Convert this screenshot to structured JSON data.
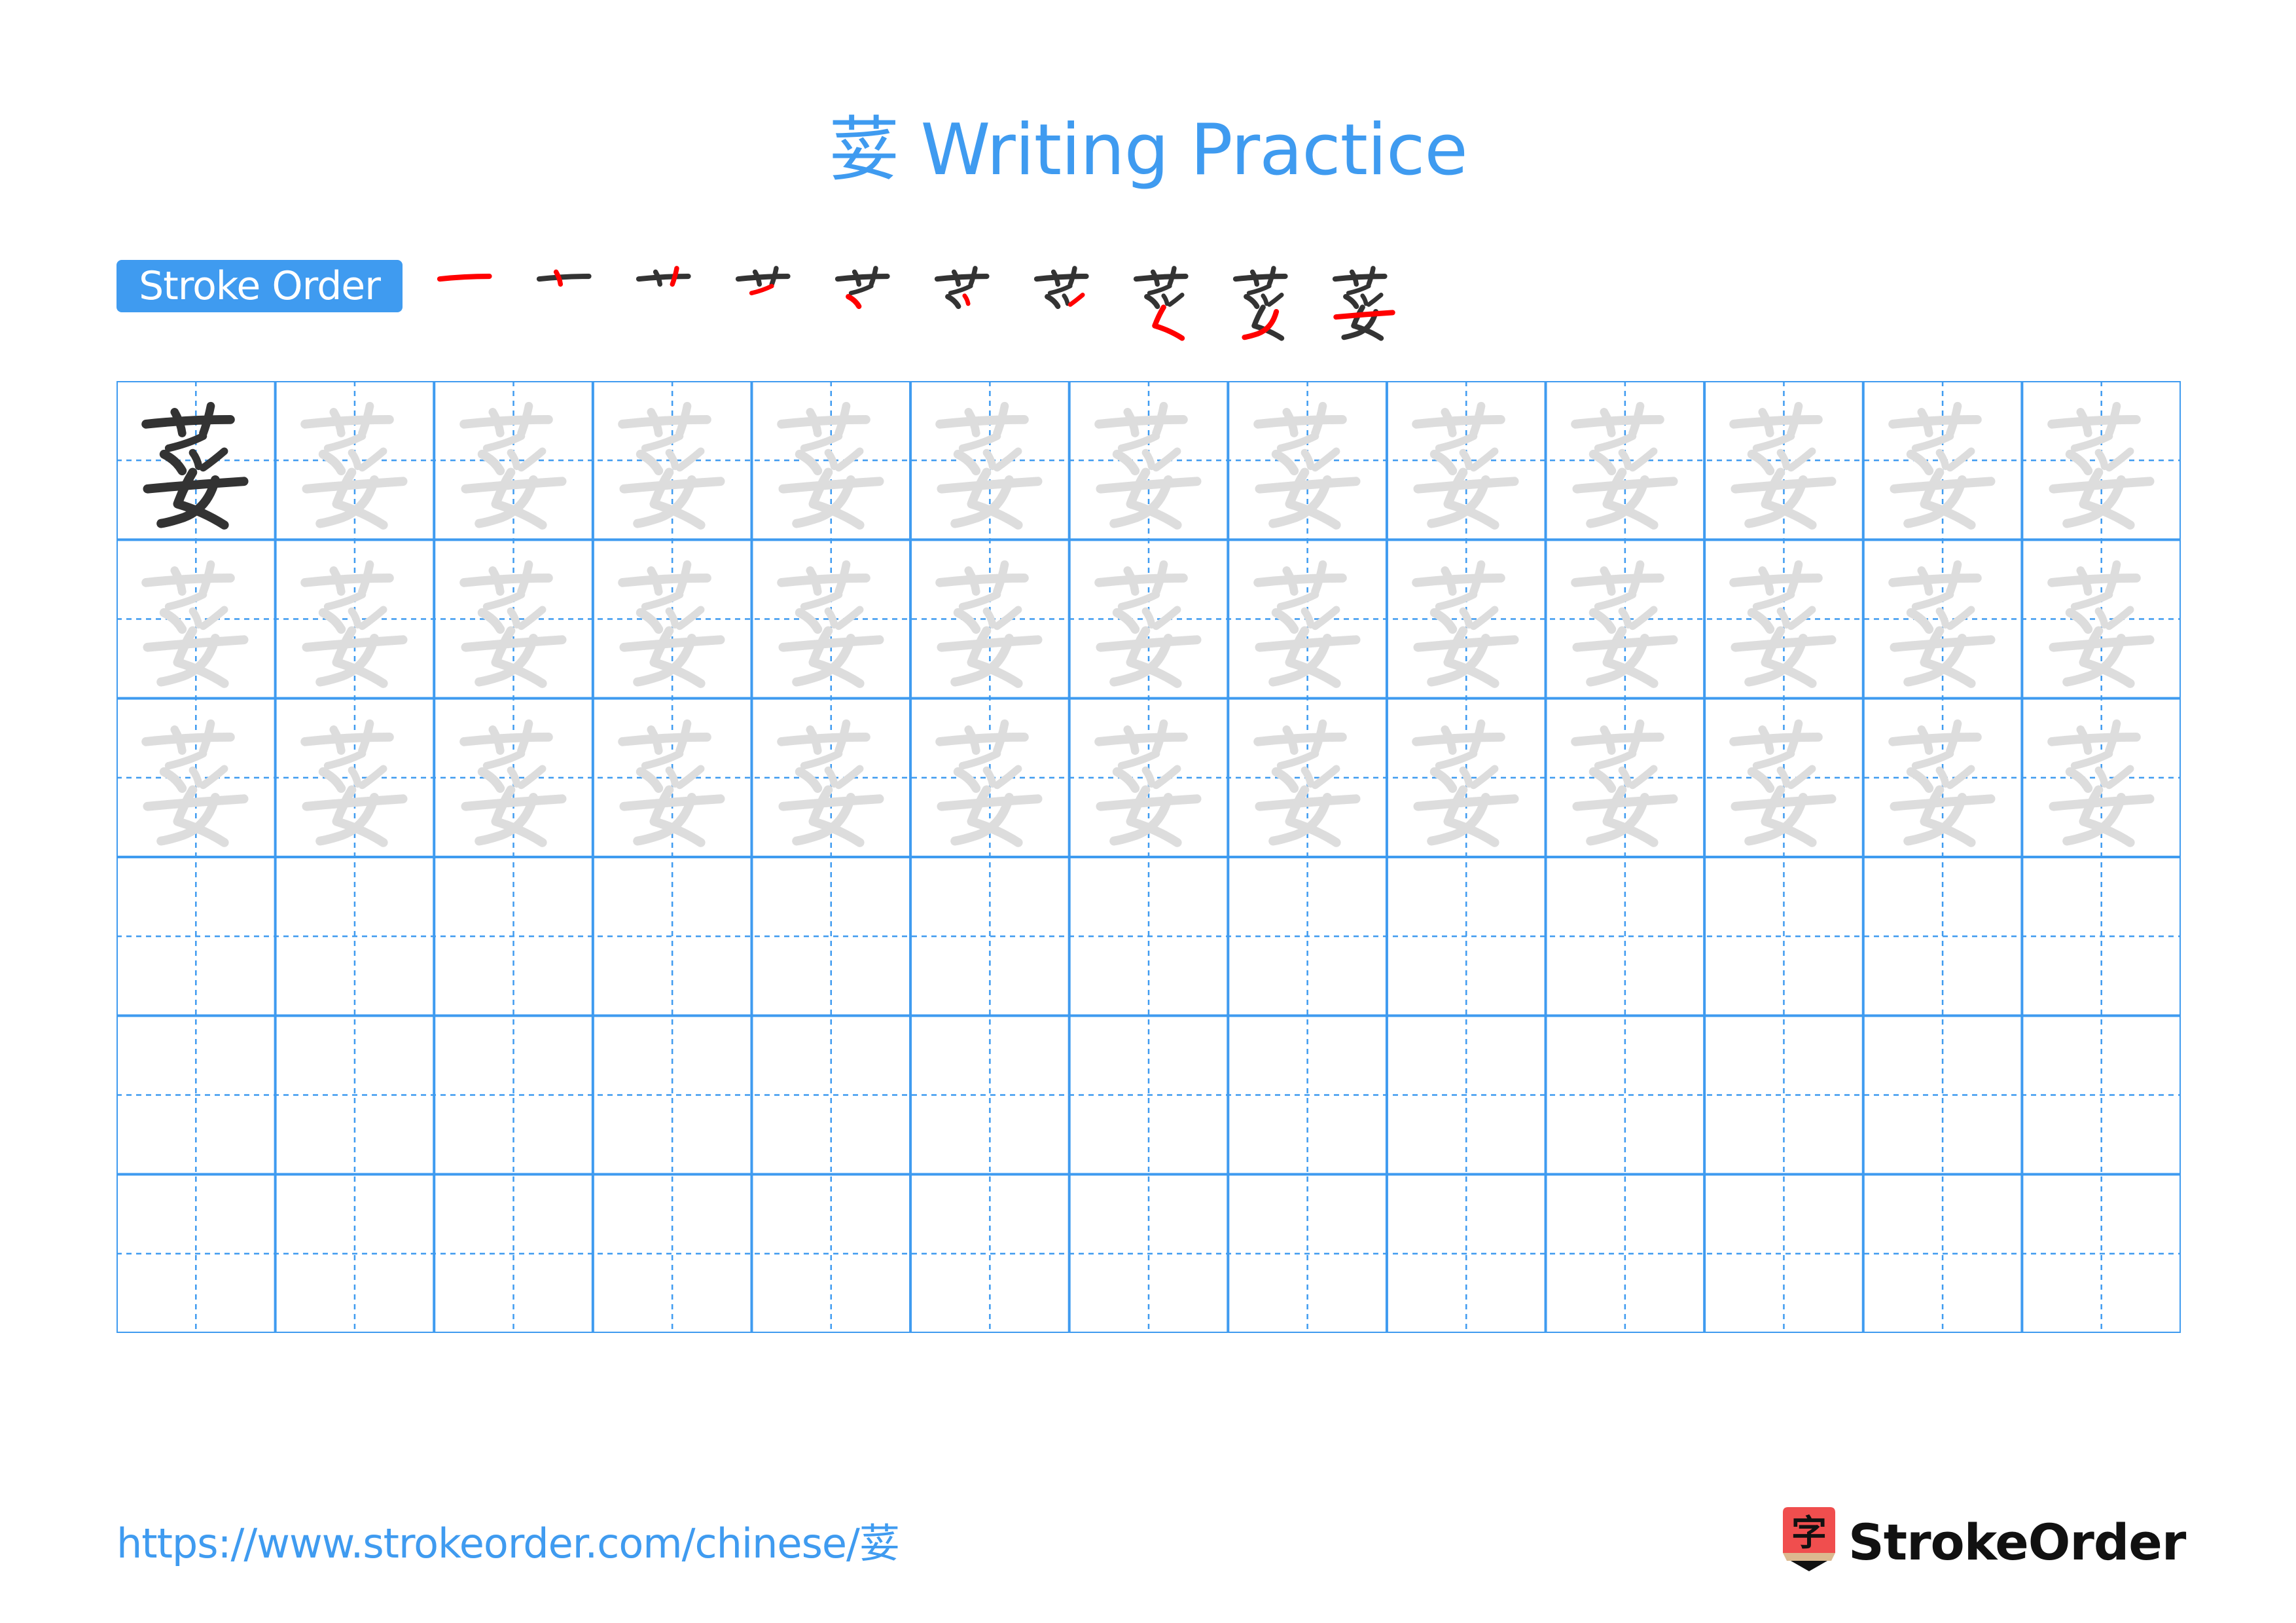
{
  "page": {
    "character": "荽",
    "title": "荽 Writing Practice",
    "stroke_order_label": "Stroke Order",
    "stroke_count": 10,
    "footer_url": "https://www.strokeorder.com/chinese/荽",
    "brand_name": "StrokeOrder",
    "brand_icon_glyph": "字"
  },
  "colors": {
    "accent": "#3f9bf0",
    "ink": "#333333",
    "trace": "#dddddd",
    "highlight_stroke": "#ff0000",
    "logo_red": "#f04e4e",
    "logo_tan": "#dcb98f"
  },
  "grid": {
    "columns": 13,
    "rows": 6,
    "rows_content": [
      "model-then-trace",
      "trace",
      "trace",
      "empty",
      "empty",
      "empty"
    ]
  }
}
